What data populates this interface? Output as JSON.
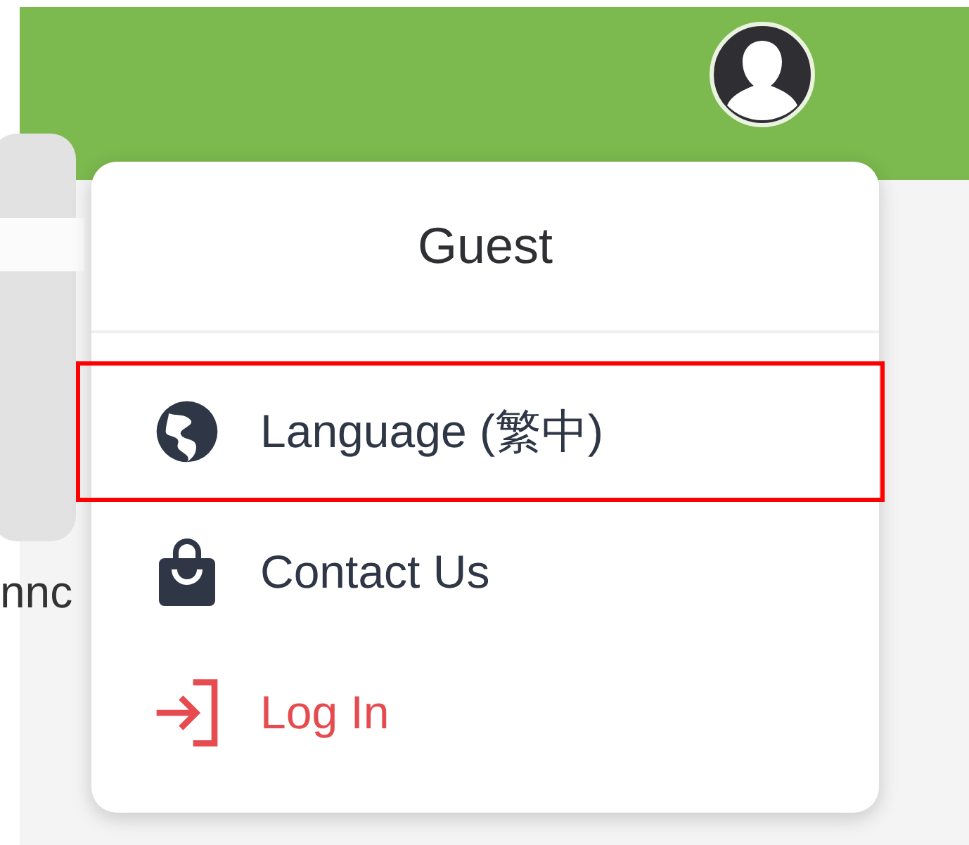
{
  "background": {
    "partial_text": "nnc"
  },
  "user_menu": {
    "title": "Guest",
    "items": [
      {
        "label": "Language (繁中)",
        "kind": "language",
        "highlighted": true
      },
      {
        "label": "Contact Us",
        "kind": "contact",
        "highlighted": false
      },
      {
        "label": "Log In",
        "kind": "login",
        "highlighted": false
      }
    ]
  }
}
